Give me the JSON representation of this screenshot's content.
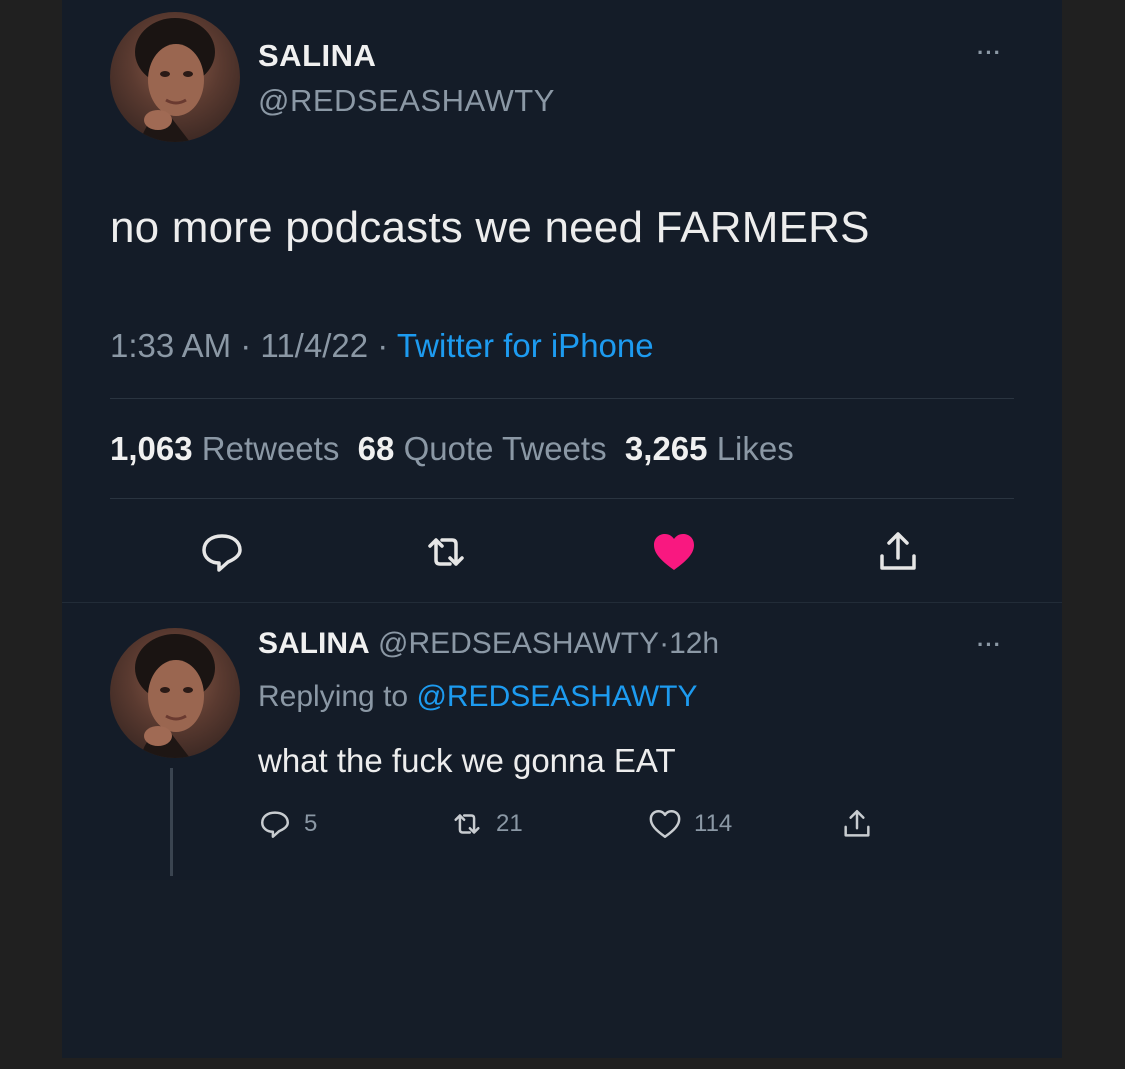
{
  "main_tweet": {
    "display_name": "SALINA",
    "handle": "@REDSEASHAWTY",
    "more_label": "···",
    "text": "no more podcasts we need FARMERS",
    "time": "1:33 AM",
    "date": "11/4/22",
    "separator": "·",
    "source": "Twitter for iPhone",
    "stats": {
      "retweets_count": "1,063",
      "retweets_label": "Retweets",
      "quotes_count": "68",
      "quotes_label": "Quote Tweets",
      "likes_count": "3,265",
      "likes_label": "Likes"
    },
    "actions": {
      "reply_icon": "reply-icon",
      "retweet_icon": "retweet-icon",
      "like_icon": "heart-filled-icon",
      "share_icon": "share-icon"
    }
  },
  "reply_tweet": {
    "display_name": "SALINA",
    "handle": "@REDSEASHAWTY",
    "separator": "·",
    "age": "12h",
    "more_label": "···",
    "replying_label": "Replying to",
    "replying_handle": "@REDSEASHAWTY",
    "text": "what the fuck we gonna EAT",
    "actions": {
      "reply_count": "5",
      "retweet_count": "21",
      "like_count": "114"
    }
  },
  "colors": {
    "background": "#141c28",
    "link": "#1d9bf0",
    "like": "#f91880",
    "muted": "#8b98a5"
  }
}
